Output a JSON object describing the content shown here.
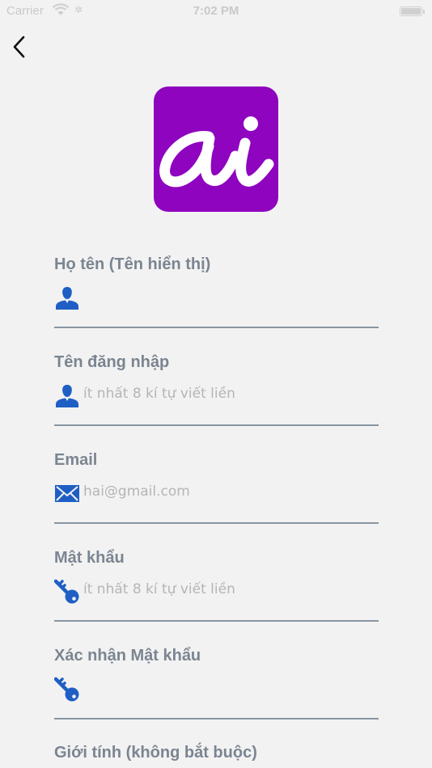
{
  "status_bar": {
    "carrier": "Carrier",
    "time": "7:02 PM"
  },
  "logo": {
    "text": "ai",
    "color": "#8e04bf"
  },
  "form": {
    "fields": [
      {
        "label": "Họ tên (Tên hiển thị)",
        "placeholder": "",
        "value": "",
        "icon": "person-icon"
      },
      {
        "label": "Tên đăng nhập",
        "placeholder": "ít nhất 8 kí tự viết liền",
        "value": "",
        "icon": "person-icon"
      },
      {
        "label": "Email",
        "placeholder": "hai@gmail.com",
        "value": "",
        "icon": "envelope-icon"
      },
      {
        "label": "Mật khẩu",
        "placeholder": "ít nhất 8 kí tự viết liền",
        "value": "",
        "icon": "key-icon"
      },
      {
        "label": "Xác nhận Mật khẩu",
        "placeholder": "",
        "value": "",
        "icon": "key-icon"
      },
      {
        "label": "Giới tính (không bắt buộc)"
      }
    ]
  },
  "colors": {
    "background": "#f2f2f2",
    "label": "#7b8591",
    "icon": "#1f5fc4",
    "underline": "#8895a2",
    "placeholder": "#b5b5b5"
  }
}
